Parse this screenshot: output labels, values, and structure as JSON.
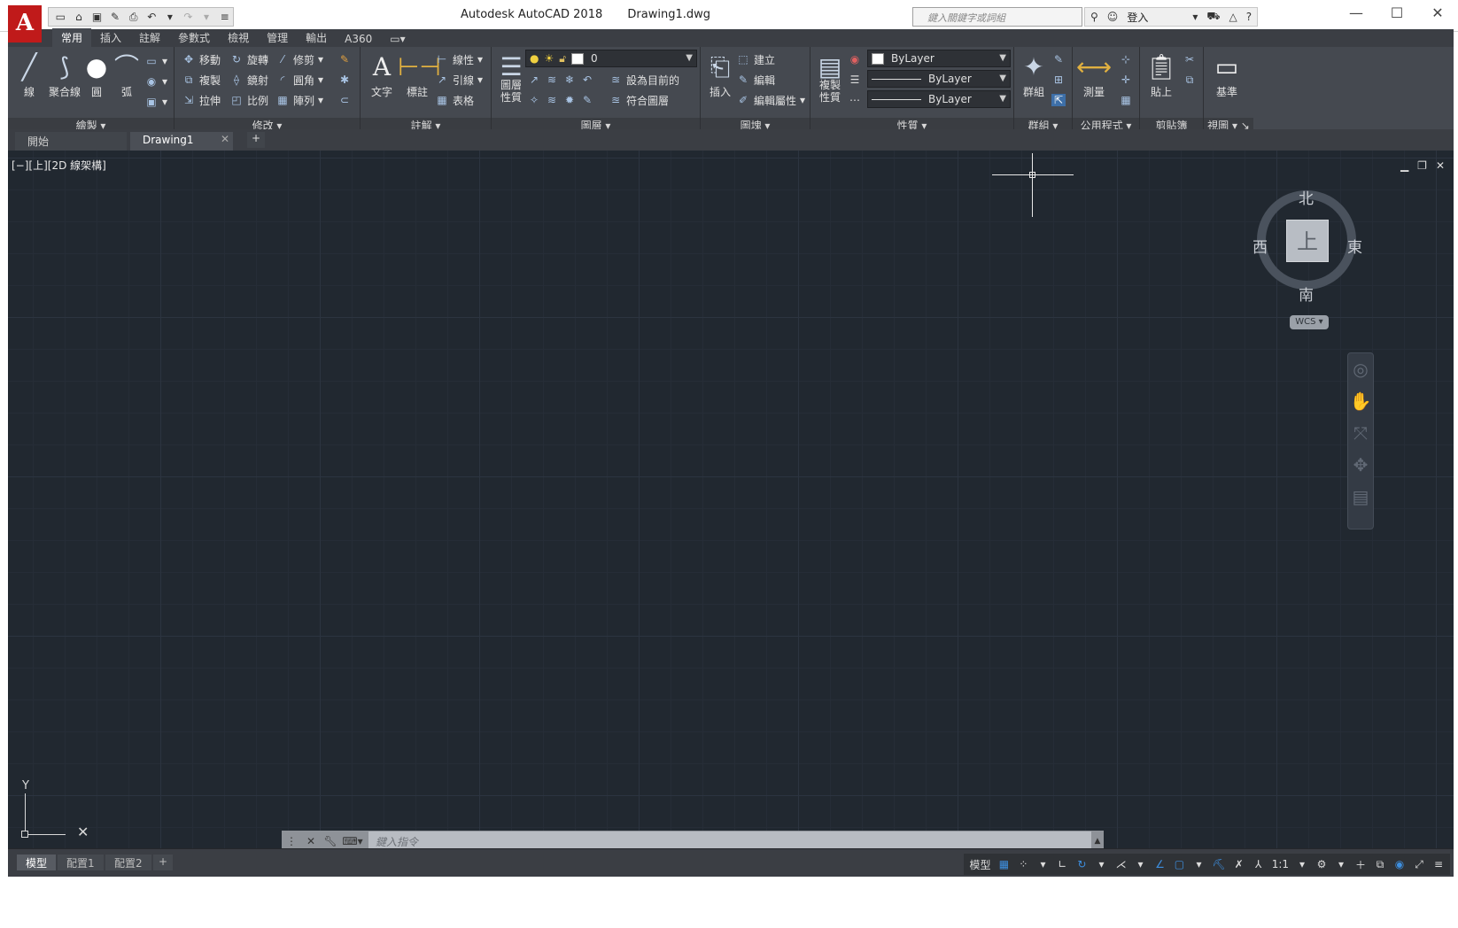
{
  "app": {
    "logo_letter": "A",
    "title": "Autodesk AutoCAD 2018",
    "document": "Drawing1.dwg",
    "search_placeholder": "鍵入關鍵字或詞組",
    "sign_in": "登入"
  },
  "ribbon_tabs": [
    "常用",
    "插入",
    "註解",
    "參數式",
    "檢視",
    "管理",
    "輸出",
    "A360"
  ],
  "panels": {
    "draw": {
      "title": "繪製",
      "line": "線",
      "polyline": "聚合線",
      "circle": "圓",
      "arc": "弧"
    },
    "modify": {
      "title": "修改",
      "move": "移動",
      "rotate": "旋轉",
      "trim": "修剪",
      "copy": "複製",
      "mirror": "鏡射",
      "fillet": "圓角",
      "stretch": "拉伸",
      "scale": "比例",
      "array": "陣列"
    },
    "annotation": {
      "title": "註解",
      "text": "文字",
      "dimension": "標註",
      "linear": "線性",
      "leader": "引線",
      "table": "表格"
    },
    "layers": {
      "title": "圖層",
      "layer_properties": "圖層\n性質",
      "current_layer": "0",
      "set_current": "設為目前的",
      "match_layer": "符合圖層"
    },
    "block": {
      "title": "圖塊",
      "insert": "插入",
      "create": "建立",
      "edit": "編輯",
      "edit_attributes": "編輯屬性"
    },
    "properties": {
      "title": "性質",
      "match_properties": "複製\n性質",
      "color": "ByLayer",
      "linetype": "ByLayer",
      "lineweight": "ByLayer"
    },
    "groups": {
      "title": "群組",
      "group": "群組"
    },
    "utilities": {
      "title": "公用程式",
      "measure": "測量"
    },
    "clipboard": {
      "title": "剪貼簿",
      "paste": "貼上"
    },
    "view": {
      "title": "視圖",
      "base": "基準"
    }
  },
  "file_tabs": {
    "start": "開始",
    "drawing": "Drawing1",
    "new": "+"
  },
  "viewport": {
    "label": "[−][上][2D 線架構]",
    "viewcube": {
      "north": "北",
      "south": "南",
      "west": "西",
      "east": "東",
      "face": "上",
      "wcs": "WCS"
    },
    "ucs": {
      "x": "X",
      "y": "Y"
    }
  },
  "command": {
    "placeholder": "鍵入指令"
  },
  "layout_tabs": [
    "模型",
    "配置1",
    "配置2"
  ],
  "status": {
    "model": "模型",
    "scale": "1:1"
  },
  "colors": {
    "accent_blue": "#3d8fe0",
    "logo_red": "#c01a1a",
    "canvas": "#212830"
  }
}
